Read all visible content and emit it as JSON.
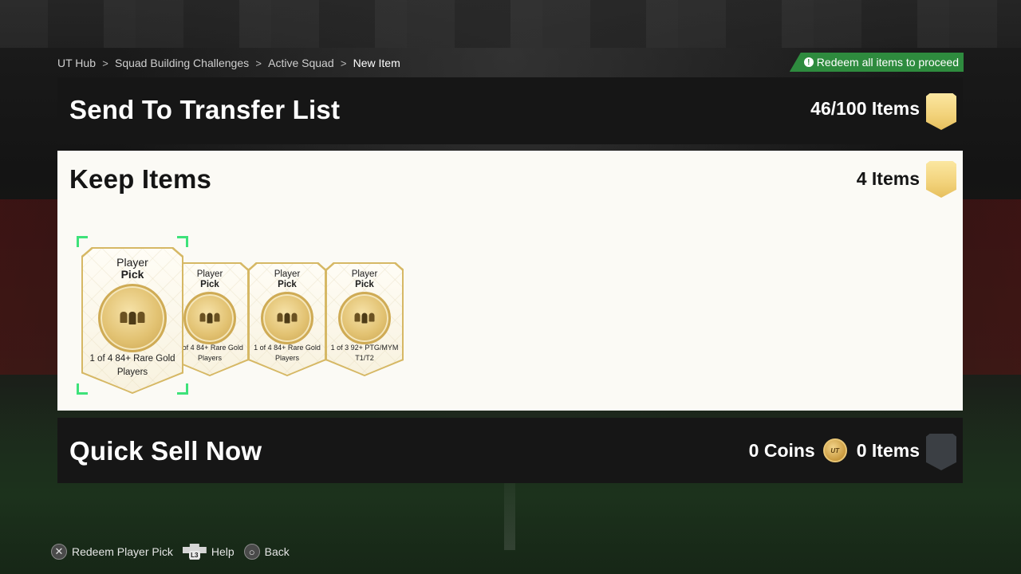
{
  "breadcrumb": {
    "items": [
      "UT Hub",
      "Squad Building Challenges",
      "Active Squad",
      "New Item"
    ],
    "separator": ">"
  },
  "banner": {
    "text": "Redeem all items to proceed",
    "icon": "info-icon",
    "color": "#2e8b3e"
  },
  "transfer": {
    "title": "Send To Transfer List",
    "count": "46/100 Items",
    "icon": "gold-shield-icon"
  },
  "keep": {
    "title": "Keep Items",
    "count": "4 Items",
    "icon": "gold-shield-icon",
    "cards": [
      {
        "title_1": "Player",
        "title_2": "Pick",
        "subtitle_1": "1 of 4 84+ Rare Gold",
        "subtitle_2": "Players",
        "selected": true
      },
      {
        "title_1": "Player",
        "title_2": "Pick",
        "subtitle_1": "1 of 4 84+ Rare Gold",
        "subtitle_2": "Players",
        "selected": false
      },
      {
        "title_1": "Player",
        "title_2": "Pick",
        "subtitle_1": "1 of 4 84+ Rare Gold",
        "subtitle_2": "Players",
        "selected": false
      },
      {
        "title_1": "Player",
        "title_2": "Pick",
        "subtitle_1": "1 of 3 92+ PTG/MYM",
        "subtitle_2": "T1/T2",
        "selected": false
      }
    ]
  },
  "quicksell": {
    "title": "Quick Sell Now",
    "coins": "0 Coins",
    "coin_icon_text": "UT",
    "count": "0 Items",
    "icon": "grey-shield-icon"
  },
  "footer": {
    "items": [
      {
        "icon": "cross-button-icon",
        "glyph": "✕",
        "label": "Redeem Player Pick"
      },
      {
        "icon": "l3-button-icon",
        "glyph": "L3",
        "label": "Help"
      },
      {
        "icon": "circle-button-icon",
        "glyph": "○",
        "label": "Back"
      }
    ]
  },
  "colors": {
    "accent_green": "#3ee27a",
    "gold": "#f2d27a",
    "panel_dark": "#161616",
    "panel_light": "#fbfaf5"
  }
}
